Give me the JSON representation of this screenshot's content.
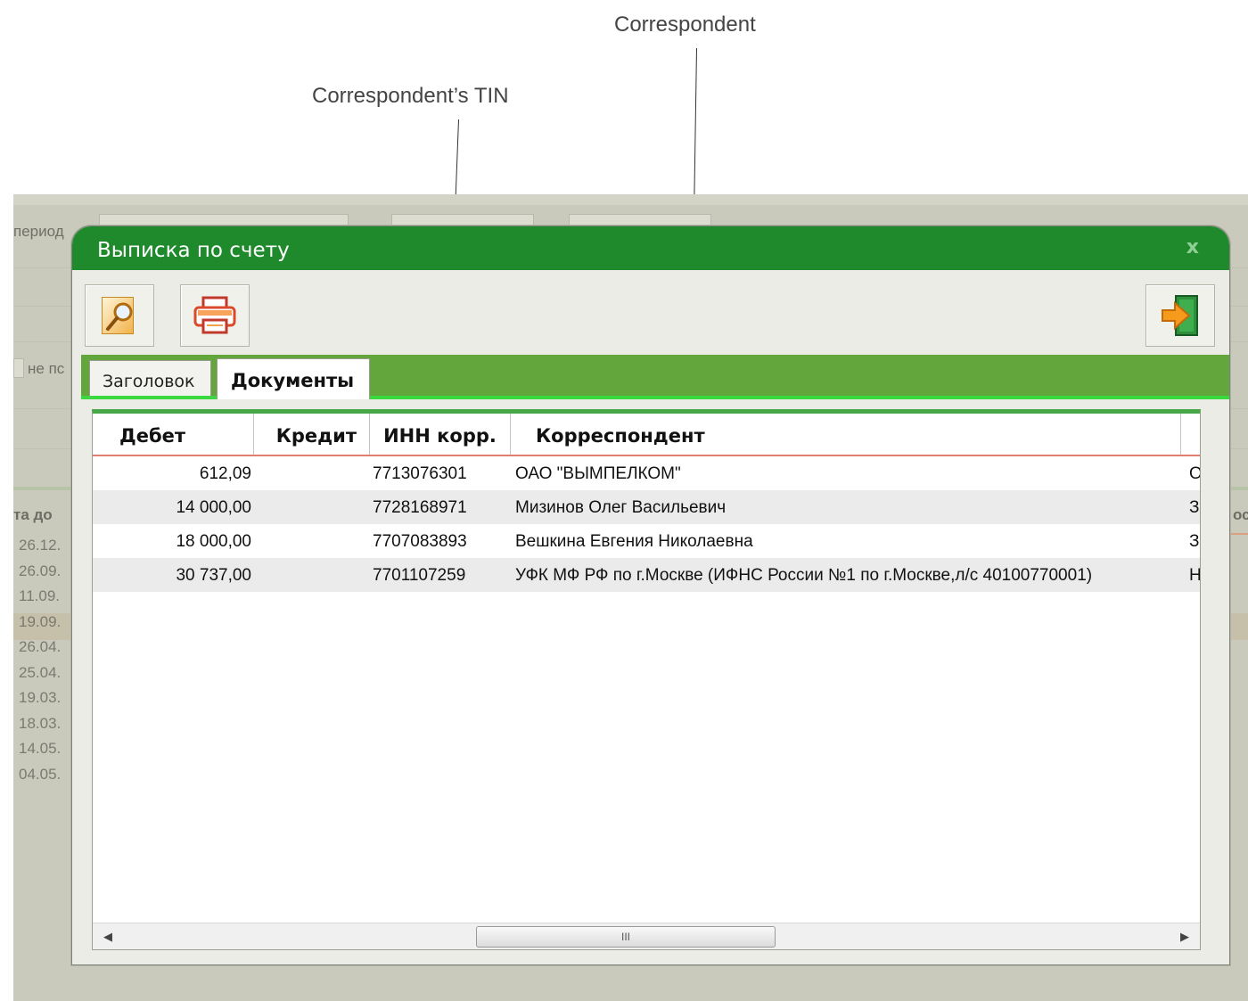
{
  "annotations": {
    "correspondent": "Correspondent",
    "correspondent_tin": "Correspondent’s TIN"
  },
  "background": {
    "period_label": "период",
    "not_label": "не пс",
    "date_header": "та до",
    "right_header": "ос",
    "dates": [
      "26.12.",
      "26.09.",
      "11.09.",
      "19.09.",
      "26.04.",
      "25.04.",
      "19.03.",
      "18.03.",
      "14.05.",
      "04.05."
    ]
  },
  "dialog": {
    "title": "Выписка по счету",
    "close_label": "x",
    "toolbar": {
      "preview_icon": "magnifier-document-icon",
      "print_icon": "printer-icon",
      "exit_icon": "exit-door-arrow-icon"
    },
    "tabs": [
      {
        "label": "Заголовок",
        "active": false
      },
      {
        "label": "Документы",
        "active": true
      }
    ],
    "grid": {
      "columns": [
        "Дебет",
        "Кредит",
        "ИНН корр.",
        "Корреспондент"
      ],
      "rows": [
        {
          "debit": "612,09",
          "credit": "",
          "inn": "7713076301",
          "correspondent": "ОАО \"ВЫМПЕЛКОМ\"",
          "extra": "О"
        },
        {
          "debit": "14 000,00",
          "credit": "",
          "inn": "7728168971",
          "correspondent": "Мизинов Олег Васильевич",
          "extra": "З"
        },
        {
          "debit": "18 000,00",
          "credit": "",
          "inn": "7707083893",
          "correspondent": "Вешкина Евгения Николаевна",
          "extra": "З"
        },
        {
          "debit": "30 737,00",
          "credit": "",
          "inn": "7701107259",
          "correspondent": "УФК МФ РФ по г.Москве (ИФНС России №1 по г.Москве,л/с 40100770001)",
          "extra": "Н"
        }
      ],
      "scroll_thumb_label": "III"
    }
  },
  "colors": {
    "title_green": "#1f8a2c",
    "tab_green": "#62a63c",
    "accent_green": "#39d93f"
  }
}
